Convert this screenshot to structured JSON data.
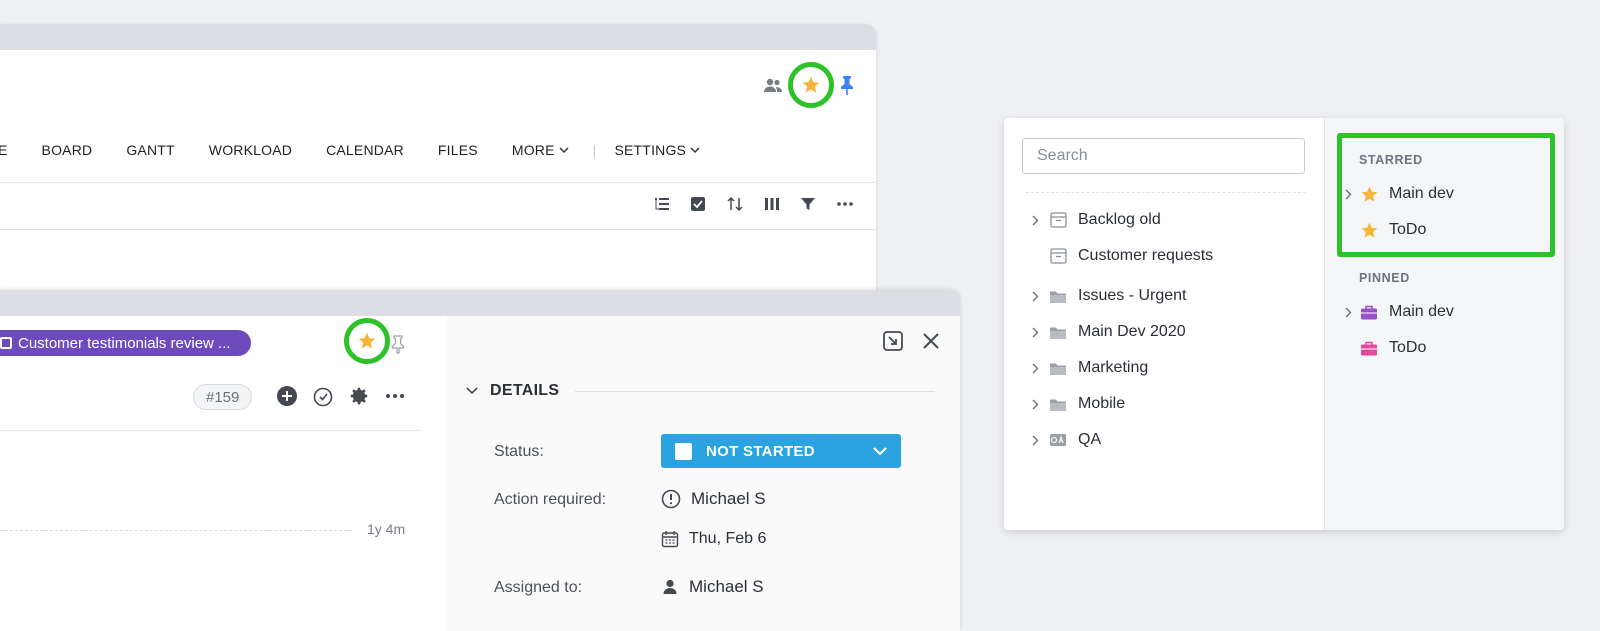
{
  "nav": {
    "items": [
      {
        "label": "E"
      },
      {
        "label": "BOARD"
      },
      {
        "label": "GANTT"
      },
      {
        "label": "WORKLOAD"
      },
      {
        "label": "CALENDAR"
      },
      {
        "label": "FILES"
      }
    ],
    "more_label": "MORE",
    "settings_label": "SETTINGS"
  },
  "task": {
    "pill_label": "Customer testimonials review ...",
    "number": "#159",
    "age": "1y 4m"
  },
  "details": {
    "heading": "DETAILS",
    "status_label": "Status:",
    "status_value": "NOT STARTED",
    "action_label": "Action required:",
    "action_user": "Michael S",
    "action_date": "Thu, Feb 6",
    "assigned_label": "Assigned to:",
    "assigned_user": "Michael S"
  },
  "panel": {
    "search_placeholder": "Search",
    "tree": [
      {
        "label": "Backlog old",
        "icon": "archive-icon",
        "expandable": true
      },
      {
        "label": "Customer requests",
        "icon": "archive-icon",
        "expandable": false
      },
      {
        "label": "Issues - Urgent",
        "icon": "folder-icon",
        "expandable": true
      },
      {
        "label": "Main Dev 2020",
        "icon": "folder-icon",
        "expandable": true
      },
      {
        "label": "Marketing",
        "icon": "folder-icon",
        "expandable": true
      },
      {
        "label": "Mobile",
        "icon": "folder-icon",
        "expandable": true
      },
      {
        "label": "QA",
        "icon": "qa-icon",
        "expandable": true
      }
    ],
    "starred_heading": "STARRED",
    "starred": [
      {
        "label": "Main dev",
        "expandable": true
      },
      {
        "label": "ToDo",
        "expandable": false
      }
    ],
    "pinned_heading": "PINNED",
    "pinned": [
      {
        "label": "Main dev",
        "expandable": true,
        "color": "#9b4fc9"
      },
      {
        "label": "ToDo",
        "expandable": false,
        "color": "#e3489a"
      }
    ]
  },
  "colors": {
    "highlight": "#2fc12a",
    "star": "#f4b63a",
    "status": "#2aa3e0",
    "pill": "#6e4bbd"
  }
}
